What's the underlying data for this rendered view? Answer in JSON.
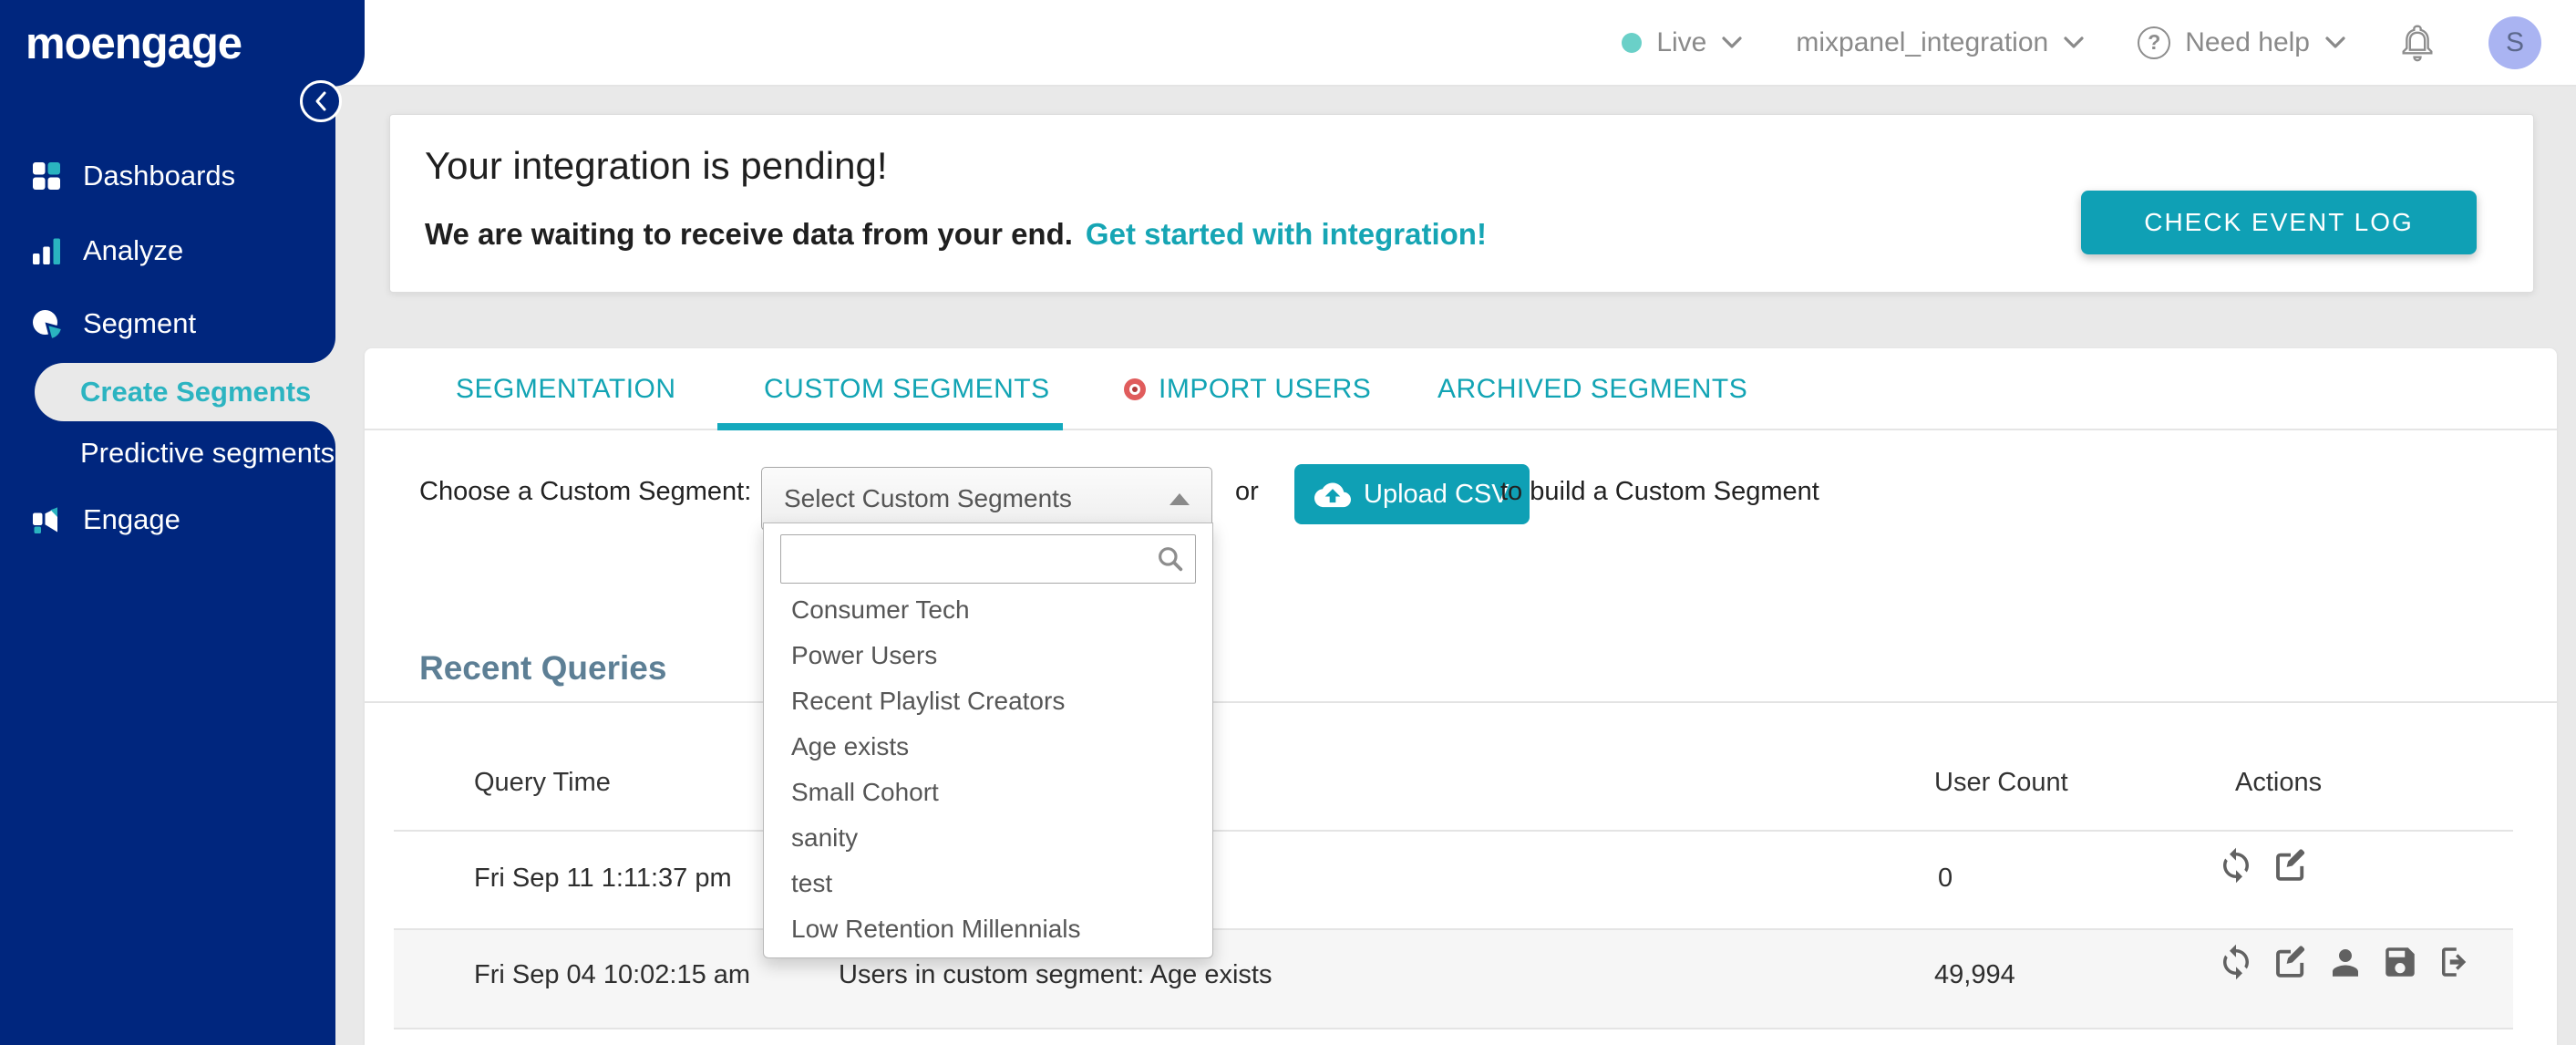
{
  "brand": {
    "logo": "moengage"
  },
  "colors": {
    "sidebar_navy": "#00267e",
    "accent_teal": "#0fa0b5",
    "link_teal": "#16a5b4",
    "active_nav_teal": "#2cb4c1",
    "live_dot": "#6ad0c8",
    "import_dot_red": "#e05c5c",
    "avatar_bg": "#aab4f2",
    "heading_slate": "#5d7f95"
  },
  "topbar": {
    "env_label": "Live",
    "project_name": "mixpanel_integration",
    "help_label": "Need help",
    "avatar_initial": "S"
  },
  "sidebar": {
    "items": [
      {
        "label": "Dashboards"
      },
      {
        "label": "Analyze"
      },
      {
        "label": "Segment"
      },
      {
        "label": "Engage"
      }
    ],
    "segment_children": [
      {
        "label": "Create Segments",
        "active": true
      },
      {
        "label": "Predictive segments",
        "active": false
      }
    ]
  },
  "banner": {
    "title": "Your integration is pending!",
    "subtitle": "We are waiting to receive data from your end.",
    "link_label": "Get started with integration!",
    "button_label": "CHECK EVENT LOG"
  },
  "tabs": [
    {
      "label": "SEGMENTATION",
      "active": false
    },
    {
      "label": "CUSTOM SEGMENTS",
      "active": true
    },
    {
      "label": "IMPORT USERS",
      "active": false,
      "has_red_dot": true
    },
    {
      "label": "ARCHIVED SEGMENTS",
      "active": false
    }
  ],
  "chooser": {
    "label": "Choose a Custom Segment:",
    "select_value": "Select Custom Segments",
    "or_text": "or",
    "upload_label": "Upload CSV",
    "suffix_text": "to build a Custom Segment"
  },
  "dropdown": {
    "search_value": "",
    "items": [
      "Consumer Tech",
      "Power Users",
      "Recent Playlist Creators",
      "Age exists",
      "Small Cohort",
      "sanity",
      "test",
      "Low Retention Millennials"
    ]
  },
  "recent": {
    "heading": "Recent Queries",
    "columns": {
      "time": "Query Time",
      "count": "User Count",
      "actions": "Actions"
    },
    "rows": [
      {
        "time": "Fri Sep 11 1:11:37 pm",
        "count": "0",
        "actions": [
          "refresh",
          "edit"
        ]
      },
      {
        "time": "Fri Sep 04 10:02:15 am",
        "desc": "Users in custom segment: Age exists",
        "count": "49,994",
        "actions": [
          "refresh",
          "edit",
          "user",
          "save",
          "export"
        ]
      }
    ]
  }
}
